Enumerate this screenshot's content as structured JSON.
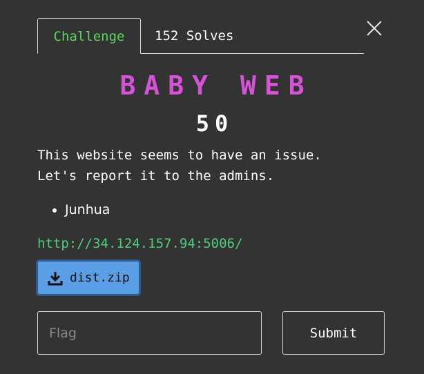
{
  "tabs": {
    "challenge_label": "Challenge",
    "solves_label": "152 Solves"
  },
  "challenge": {
    "title": "BABY WEB",
    "points": "50",
    "description_lines": [
      "This website seems to have an issue.",
      "Let's report it to the admins."
    ],
    "authors": [
      "Junhua"
    ],
    "link": "http://34.124.157.94:5006/",
    "files": [
      {
        "name": "dist.zip",
        "icon": "download-icon"
      }
    ]
  },
  "form": {
    "flag_placeholder": "Flag",
    "flag_value": "",
    "submit_label": "Submit"
  },
  "colors": {
    "background": "#333333",
    "title": "#d652d6",
    "active_tab": "#5fd45f",
    "link": "#4fcf7e",
    "file_button": "#5a9ee6"
  },
  "icons": {
    "close": "close-icon",
    "download": "download-icon"
  }
}
